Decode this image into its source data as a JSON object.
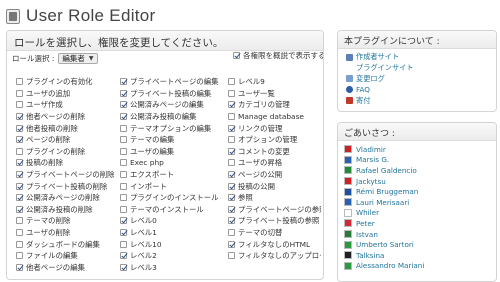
{
  "page": {
    "title": "User Role Editor"
  },
  "main_panel": {
    "heading": "ロールを選択し、権限を変更してください。",
    "role_label": "ロール選択 :",
    "role_value": "編集者",
    "overview_label": "各権限を概説で表示する",
    "overview_checked": true
  },
  "capabilities": [
    [
      {
        "label": "プラグインの有効化",
        "checked": false
      },
      {
        "label": "プライベートページの編集",
        "checked": true
      },
      {
        "label": "レベル9",
        "checked": false
      }
    ],
    [
      {
        "label": "ユーザの追加",
        "checked": false
      },
      {
        "label": "プライベート投稿の編集",
        "checked": true
      },
      {
        "label": "ユーザ一覧",
        "checked": false
      }
    ],
    [
      {
        "label": "ユーザ作成",
        "checked": false
      },
      {
        "label": "公開済みページの編集",
        "checked": true
      },
      {
        "label": "カテゴリの管理",
        "checked": true
      }
    ],
    [
      {
        "label": "他者ページの削除",
        "checked": true
      },
      {
        "label": "公開済み投稿の編集",
        "checked": true
      },
      {
        "label": "Manage database",
        "checked": false
      }
    ],
    [
      {
        "label": "他者投稿の削除",
        "checked": true
      },
      {
        "label": "テーマオプションの編集",
        "checked": false
      },
      {
        "label": "リンクの管理",
        "checked": true
      }
    ],
    [
      {
        "label": "ページの削除",
        "checked": true
      },
      {
        "label": "テーマの編集",
        "checked": false
      },
      {
        "label": "オプションの管理",
        "checked": false
      }
    ],
    [
      {
        "label": "プラグインの削除",
        "checked": false
      },
      {
        "label": "ユーザの編集",
        "checked": false
      },
      {
        "label": "コメントの変更",
        "checked": true
      }
    ],
    [
      {
        "label": "投稿の削除",
        "checked": true
      },
      {
        "label": "Exec php",
        "checked": false
      },
      {
        "label": "ユーザの昇格",
        "checked": false
      }
    ],
    [
      {
        "label": "プライベートページの削除",
        "checked": true
      },
      {
        "label": "エクスポート",
        "checked": false
      },
      {
        "label": "ページの公開",
        "checked": true
      }
    ],
    [
      {
        "label": "プライベート投稿の削除",
        "checked": true
      },
      {
        "label": "インポート",
        "checked": false
      },
      {
        "label": "投稿の公開",
        "checked": true
      }
    ],
    [
      {
        "label": "公開済みページの削除",
        "checked": true
      },
      {
        "label": "プラグインのインストール",
        "checked": false
      },
      {
        "label": "参照",
        "checked": true
      }
    ],
    [
      {
        "label": "公開済み投稿の削除",
        "checked": true
      },
      {
        "label": "テーマのインストール",
        "checked": false
      },
      {
        "label": "プライベートページの参照",
        "checked": true
      }
    ],
    [
      {
        "label": "テーマの削除",
        "checked": false
      },
      {
        "label": "レベル0",
        "checked": true
      },
      {
        "label": "プライベート投稿の参照",
        "checked": true
      }
    ],
    [
      {
        "label": "ユーザの削除",
        "checked": false
      },
      {
        "label": "レベル1",
        "checked": true
      },
      {
        "label": "テーマの切替",
        "checked": false
      }
    ],
    [
      {
        "label": "ダッシュボードの編集",
        "checked": false
      },
      {
        "label": "レベル10",
        "checked": false
      },
      {
        "label": "フィルタなしのHTML",
        "checked": true
      }
    ],
    [
      {
        "label": "ファイルの編集",
        "checked": false
      },
      {
        "label": "レベル2",
        "checked": true
      },
      {
        "label": "フィルタなしのアップロード",
        "checked": false
      }
    ],
    [
      {
        "label": "他者ページの編集",
        "checked": true
      },
      {
        "label": "レベル3",
        "checked": true
      },
      {
        "label": "",
        "checked": false
      }
    ]
  ],
  "about_panel": {
    "heading": "本プラグインについて :",
    "links": [
      {
        "label": "作成者サイト",
        "icon": "person-icon",
        "color": "#5b7fb7"
      },
      {
        "label": "プラグインサイト",
        "icon": "none",
        "color": ""
      },
      {
        "label": "変更ログ",
        "icon": "document-icon",
        "color": "#7aa0d0"
      },
      {
        "label": "FAQ",
        "icon": "help-icon",
        "color": "#2d5ca8"
      },
      {
        "label": "寄付",
        "icon": "donate-icon",
        "color": "#c0392b"
      }
    ]
  },
  "thanks_panel": {
    "heading": "ごあいさつ :",
    "users": [
      {
        "name": "Vladimir",
        "flag": "#cf2020"
      },
      {
        "name": "Marsis G.",
        "flag": "#2a61b4"
      },
      {
        "name": "Rafael Galdencio",
        "flag": "#1f8a3a"
      },
      {
        "name": "Jackytsu",
        "flag": "#d02020"
      },
      {
        "name": "Rémi Bruggeman",
        "flag": "#1c4fa0"
      },
      {
        "name": "Lauri Merisaari",
        "flag": "#2a61b4"
      },
      {
        "name": "Whiler",
        "flag": "#ffffff"
      },
      {
        "name": "Peter",
        "flag": "#ce2b37"
      },
      {
        "name": "Istvan",
        "flag": "#2c7a3a"
      },
      {
        "name": "Umberto Sartori",
        "flag": "#2b9a3f"
      },
      {
        "name": "Talksina",
        "flag": "#222222"
      },
      {
        "name": "Alessandro Mariani",
        "flag": "#2b9a3f"
      }
    ]
  }
}
